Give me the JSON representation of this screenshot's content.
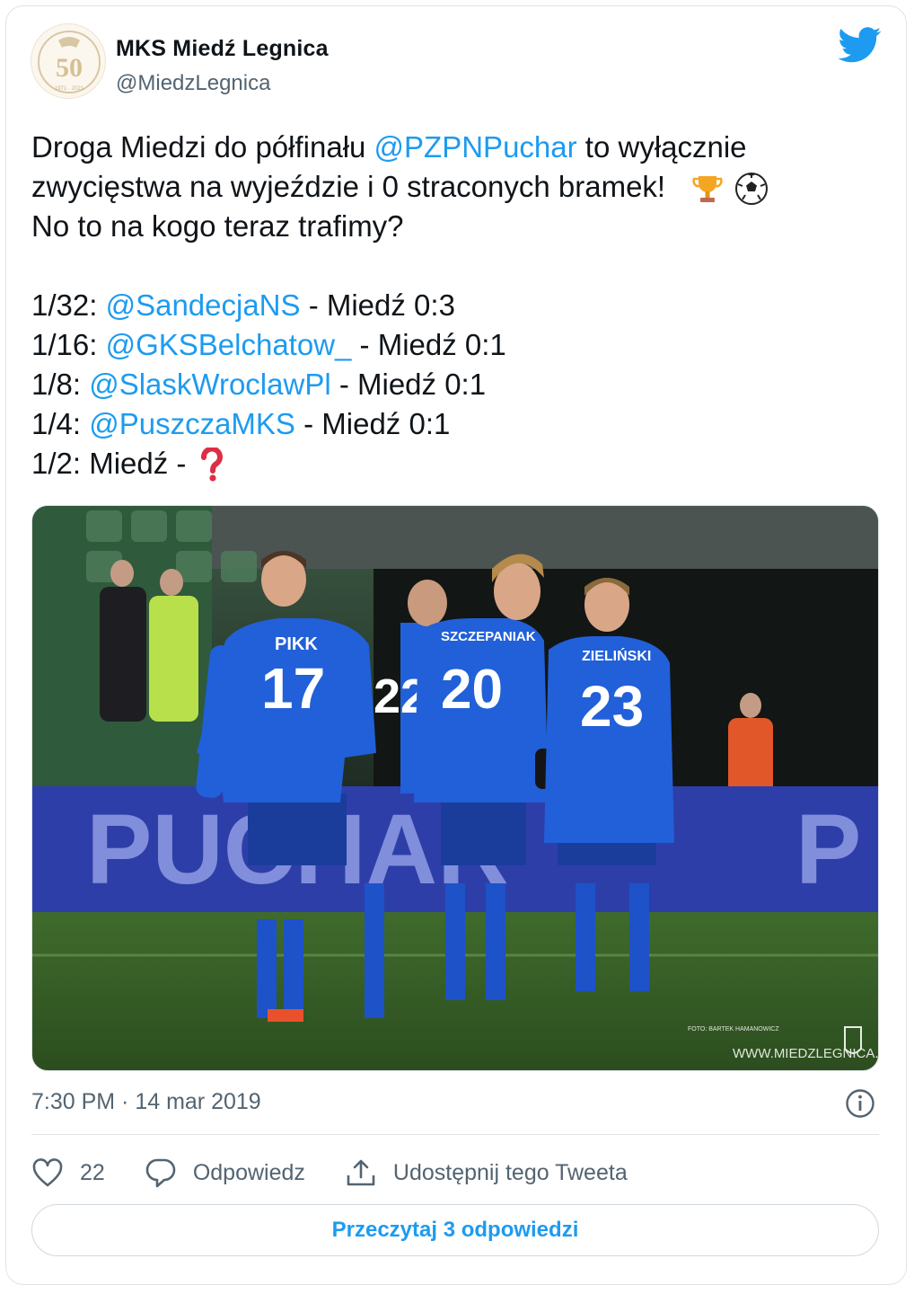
{
  "author": {
    "name": "MKS Miedź Legnica",
    "handle": "@MiedzLegnica",
    "avatar_badge": "50"
  },
  "tweet": {
    "line1": {
      "pre": "Droga Miedzi do półfinału ",
      "mention": "@PZPNPuchar",
      "post": " to wyłącznie"
    },
    "line2": "zwycięstwa na wyjeździe i 0 straconych bramek!",
    "line2_emoji": [
      "trophy-icon",
      "soccer-ball-icon"
    ],
    "line3": "No to na kogo teraz trafimy?",
    "results": [
      {
        "round": "1/32: ",
        "mention": "@SandecjaNS",
        "score": " - Miedź 0:3"
      },
      {
        "round": "1/16: ",
        "mention": "@GKSBelchatow_",
        "score": " - Miedź 0:1"
      },
      {
        "round": "1/8: ",
        "mention": "@SlaskWroclawPl",
        "score": " - Miedź 0:1"
      },
      {
        "round": "1/4: ",
        "mention": "@PuszczaMKS",
        "score": " - Miedź 0:1"
      }
    ],
    "final_line": "1/2: Miedź - ",
    "final_emoji": "question-mark-icon"
  },
  "photo": {
    "players": [
      {
        "name": "PIKK",
        "number": "17"
      },
      {
        "name": "",
        "number": "22"
      },
      {
        "name": "SZCZEPANIAK",
        "number": "20"
      },
      {
        "name": "ZIELIŃSKI",
        "number": "23"
      }
    ],
    "banner_text": "PUCHAR",
    "watermark": "WWW.MIEDZLEGNICA.EU",
    "credit": "FOTO: BARTEK HAMANOWICZ"
  },
  "meta": {
    "timestamp": "7:30 PM · 14 mar 2019"
  },
  "actions": {
    "likes": "22",
    "reply_label": "Odpowiedz",
    "share_label": "Udostępnij tego Tweeta"
  },
  "read_replies_label": "Przeczytaj 3 odpowiedzi",
  "colors": {
    "accent": "#1d9bf0",
    "text": "#0f1419",
    "muted": "#536471",
    "border": "#dfe3e7"
  }
}
